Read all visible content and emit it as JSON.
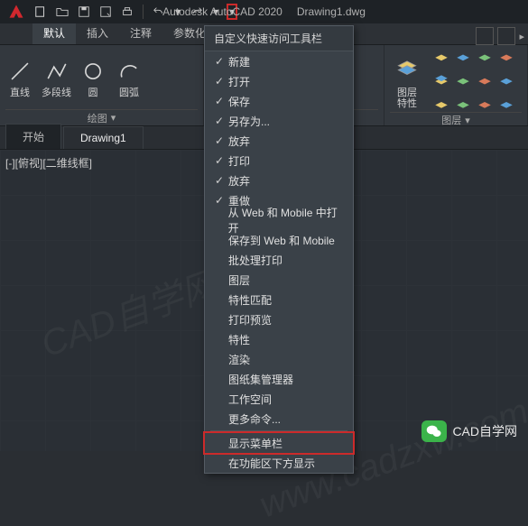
{
  "app": {
    "name": "Autodesk AutoCAD 2020",
    "document": "Drawing1.dwg"
  },
  "tabs": {
    "items": [
      "默认",
      "插入",
      "注释",
      "参数化"
    ],
    "active_index": 0
  },
  "ribbon": {
    "draw_panel": {
      "title": "绘图",
      "tools": {
        "line": "直线",
        "polyline": "多段线",
        "circle": "圆",
        "arc": "圆弧"
      }
    },
    "layer_panel": {
      "title": "图层",
      "button": "图层\n特性"
    }
  },
  "doc_tabs": {
    "items": [
      "开始",
      "Drawing1"
    ],
    "active_index": 1
  },
  "canvas": {
    "view_label": "[-][俯视][二维线框]"
  },
  "qat_menu": {
    "header": "自定义快速访问工具栏",
    "items": [
      {
        "label": "新建",
        "checked": true
      },
      {
        "label": "打开",
        "checked": true
      },
      {
        "label": "保存",
        "checked": true
      },
      {
        "label": "另存为...",
        "checked": true
      },
      {
        "label": "放弃",
        "checked": true
      },
      {
        "label": "打印",
        "checked": true
      },
      {
        "label": "放弃",
        "checked": true
      },
      {
        "label": "重做",
        "checked": true
      },
      {
        "label": "从 Web 和 Mobile 中打开",
        "checked": false
      },
      {
        "label": "保存到 Web 和 Mobile",
        "checked": false
      },
      {
        "label": "批处理打印",
        "checked": false
      },
      {
        "label": "图层",
        "checked": false
      },
      {
        "label": "特性匹配",
        "checked": false
      },
      {
        "label": "打印预览",
        "checked": false
      },
      {
        "label": "特性",
        "checked": false
      },
      {
        "label": "渲染",
        "checked": false
      },
      {
        "label": "图纸集管理器",
        "checked": false
      },
      {
        "label": "工作空间",
        "checked": false
      },
      {
        "label": "更多命令...",
        "checked": false,
        "sep_after": true
      },
      {
        "label": "显示菜单栏",
        "checked": false,
        "highlight": true
      },
      {
        "label": "在功能区下方显示",
        "checked": false
      }
    ]
  },
  "branding": {
    "watermark1": "CAD自学网",
    "watermark2": "www.cadzxw.com",
    "wechat": "CAD自学网"
  }
}
